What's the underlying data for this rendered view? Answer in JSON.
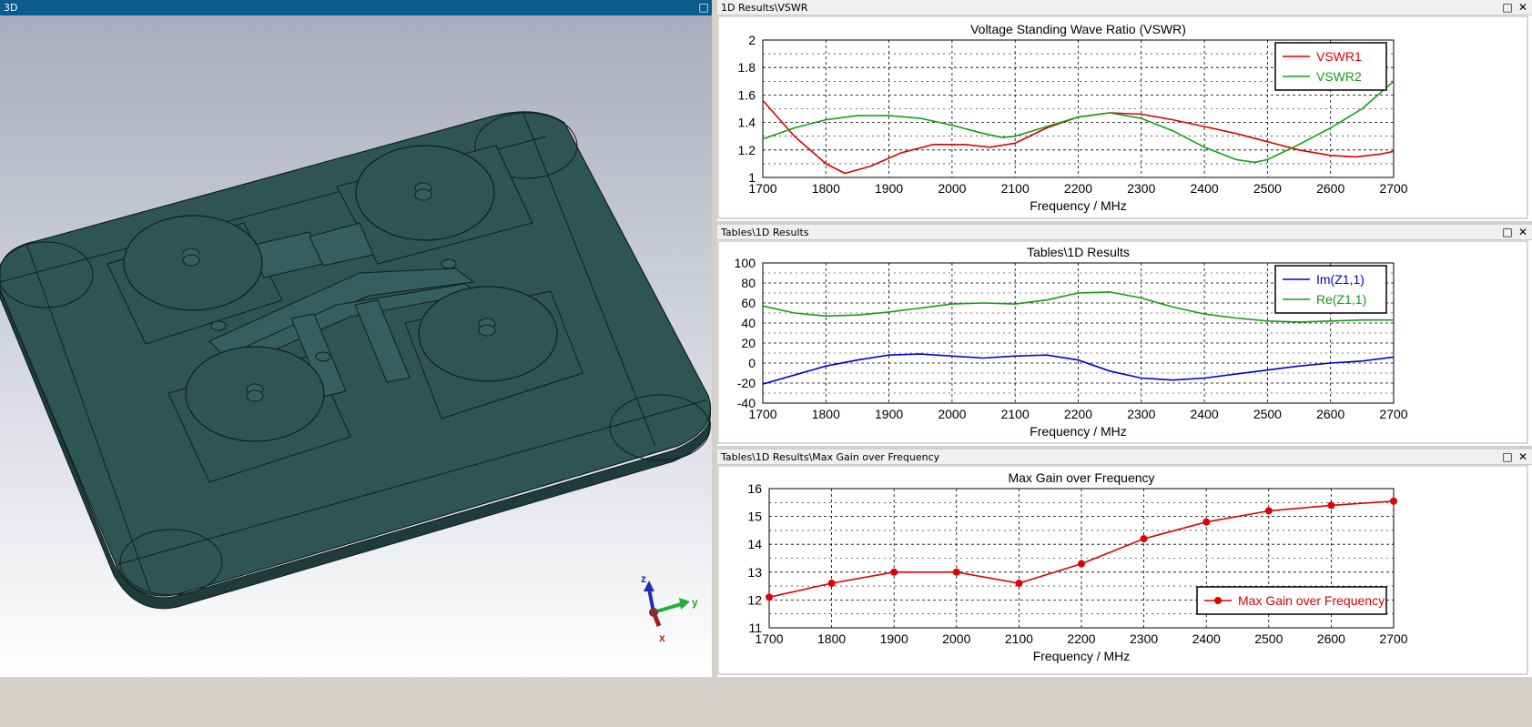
{
  "view3d": {
    "title": "3D",
    "axes": {
      "z": "z",
      "y": "y",
      "x": "x"
    },
    "colors": {
      "body": "#2e5554",
      "edge": "#0f1f1f",
      "bg_top": "#a9acbc",
      "bg_bottom": "#ffffff"
    }
  },
  "panels": [
    {
      "title": "1D Results\\VSWR"
    },
    {
      "title": "Tables\\1D Results"
    },
    {
      "title": "Tables\\1D Results\\Max Gain over Frequency"
    }
  ],
  "chart_data": [
    {
      "type": "line",
      "title": "Voltage Standing Wave Ratio (VSWR)",
      "xlabel": "Frequency / MHz",
      "ylabel": "",
      "xlim": [
        1700,
        2700
      ],
      "ylim": [
        1,
        2
      ],
      "xticks": [
        1700,
        1800,
        1900,
        2000,
        2100,
        2200,
        2300,
        2400,
        2500,
        2600,
        2700
      ],
      "yticks": [
        1,
        1.2,
        1.4,
        1.6,
        1.8,
        2
      ],
      "grid": true,
      "legend": "top-right",
      "series": [
        {
          "name": "VSWR1",
          "color": "#e00000",
          "x": [
            1700,
            1750,
            1800,
            1830,
            1870,
            1920,
            1970,
            2020,
            2060,
            2100,
            2150,
            2200,
            2250,
            2300,
            2350,
            2400,
            2450,
            2500,
            2550,
            2600,
            2640,
            2680,
            2700
          ],
          "y": [
            1.56,
            1.3,
            1.1,
            1.03,
            1.08,
            1.18,
            1.24,
            1.24,
            1.22,
            1.25,
            1.36,
            1.44,
            1.47,
            1.46,
            1.42,
            1.37,
            1.32,
            1.26,
            1.2,
            1.16,
            1.15,
            1.17,
            1.19
          ]
        },
        {
          "name": "VSWR2",
          "color": "#10a010",
          "x": [
            1700,
            1750,
            1800,
            1850,
            1900,
            1950,
            2000,
            2050,
            2080,
            2100,
            2150,
            2200,
            2250,
            2300,
            2350,
            2400,
            2450,
            2480,
            2500,
            2550,
            2600,
            2650,
            2700
          ],
          "y": [
            1.28,
            1.36,
            1.42,
            1.45,
            1.45,
            1.43,
            1.38,
            1.32,
            1.29,
            1.3,
            1.37,
            1.44,
            1.47,
            1.43,
            1.34,
            1.22,
            1.13,
            1.11,
            1.13,
            1.24,
            1.36,
            1.5,
            1.7
          ]
        }
      ]
    },
    {
      "type": "line",
      "title": "Tables\\1D Results",
      "xlabel": "Frequency / MHz",
      "ylabel": "",
      "xlim": [
        1700,
        2700
      ],
      "ylim": [
        -40,
        100
      ],
      "xticks": [
        1700,
        1800,
        1900,
        2000,
        2100,
        2200,
        2300,
        2400,
        2500,
        2600,
        2700
      ],
      "yticks": [
        -40,
        -20,
        0,
        20,
        40,
        60,
        80,
        100
      ],
      "grid": true,
      "legend": "top-right",
      "series": [
        {
          "name": "Im(Z1,1)",
          "color": "#0000d0",
          "x": [
            1700,
            1750,
            1800,
            1850,
            1900,
            1950,
            2000,
            2050,
            2100,
            2150,
            2200,
            2250,
            2300,
            2350,
            2400,
            2450,
            2500,
            2550,
            2600,
            2650,
            2700
          ],
          "y": [
            -21,
            -12,
            -3,
            3,
            8,
            9,
            7,
            5,
            7,
            8,
            3,
            -8,
            -15,
            -17,
            -15,
            -11,
            -7,
            -3,
            0,
            2,
            6
          ]
        },
        {
          "name": "Re(Z1,1)",
          "color": "#10a010",
          "x": [
            1700,
            1750,
            1800,
            1850,
            1900,
            1950,
            2000,
            2050,
            2100,
            2150,
            2200,
            2250,
            2300,
            2350,
            2400,
            2450,
            2500,
            2550,
            2600,
            2650,
            2700
          ],
          "y": [
            57,
            50,
            47,
            48,
            51,
            55,
            59,
            60,
            59,
            63,
            70,
            71,
            65,
            56,
            49,
            45,
            42,
            41,
            42,
            43,
            43
          ]
        }
      ]
    },
    {
      "type": "line",
      "title": "Max Gain over Frequency",
      "xlabel": "Frequency / MHz",
      "ylabel": "",
      "xlim": [
        1700,
        2700
      ],
      "ylim": [
        11,
        16
      ],
      "xticks": [
        1700,
        1800,
        1900,
        2000,
        2100,
        2200,
        2300,
        2400,
        2500,
        2600,
        2700
      ],
      "yticks": [
        11,
        12,
        13,
        14,
        15,
        16
      ],
      "grid": true,
      "legend": "bottom-right",
      "markers": true,
      "series": [
        {
          "name": "Max Gain over Frequency",
          "color": "#e00000",
          "x": [
            1700,
            1800,
            1900,
            2000,
            2100,
            2200,
            2300,
            2400,
            2500,
            2600,
            2700
          ],
          "y": [
            12.1,
            12.6,
            13.0,
            13.0,
            12.6,
            13.3,
            14.2,
            14.8,
            15.2,
            15.4,
            15.55
          ]
        }
      ]
    }
  ]
}
